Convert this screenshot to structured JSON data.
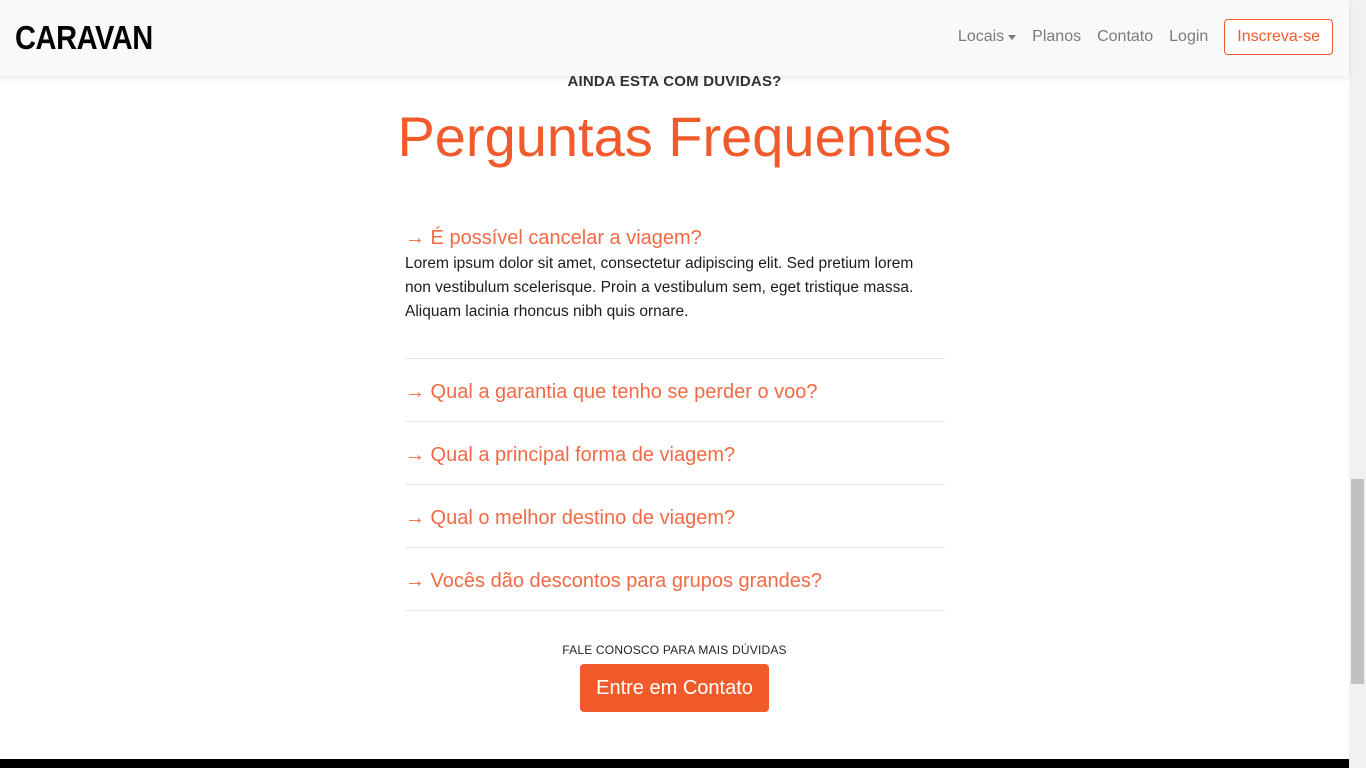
{
  "navbar": {
    "brand": "CARAVAN",
    "links": [
      "Locais",
      "Planos",
      "Contato",
      "Login"
    ],
    "signup_label": "Inscreva-se"
  },
  "faq_section": {
    "eyebrow": "AINDA ESTA COM DUVIDAS?",
    "title": "Perguntas Frequentes",
    "items": [
      {
        "question": "→ É possível cancelar a viagem?",
        "answer_lines": [
          "Lorem ipsum dolor sit amet, consectetur adipiscing elit. Sed pretium lorem",
          "non vestibulum scelerisque. Proin a vestibulum sem, eget tristique massa.",
          "Aliquam lacinia rhoncus nibh quis ornare."
        ]
      },
      {
        "question": "→ Qual a garantia que tenho se perder o voo?"
      },
      {
        "question": "→ Qual a principal forma de viagem?"
      },
      {
        "question": "→ Qual o melhor destino de viagem?"
      },
      {
        "question": "→ Vocês dão descontos para grupos grandes?"
      }
    ],
    "contact_prompt": "FALE CONOSCO PARA MAIS DÚVIDAS",
    "contact_button": "Entre em Contato"
  },
  "colors": {
    "accent": "#f15a2b",
    "question_text": "#f26a45",
    "navbar_bg": "#f8f9fa",
    "nav_link": "#7a7a7a"
  },
  "icons": {
    "locais_dropdown": "caret-down-icon"
  }
}
